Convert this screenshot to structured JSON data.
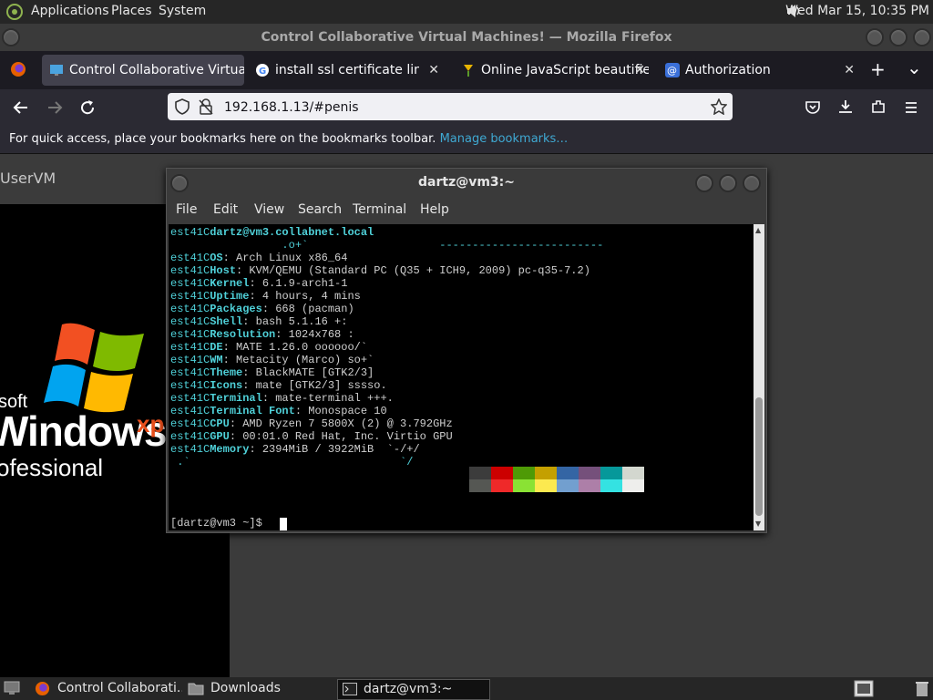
{
  "top_panel": {
    "menus": [
      "Applications",
      "Places",
      "System"
    ],
    "clock": "Wed Mar 15, 10:35 PM"
  },
  "firefox": {
    "window_title": "Control Collaborative Virtual Machines! — Mozilla Firefox",
    "tabs": [
      {
        "label": "Control Collaborative Virtua",
        "icon": "monitor-icon",
        "active": true
      },
      {
        "label": "install ssl certificate linux - G",
        "icon": "google-icon",
        "active": false
      },
      {
        "label": "Online JavaScript beautifier",
        "icon": "beautifier-icon",
        "active": false
      },
      {
        "label": "Authorization",
        "icon": "at-icon",
        "active": false
      }
    ],
    "tab_close": "✕",
    "new_tab": "+",
    "list_tabs": "⌄",
    "url": "192.168.1.13/#penis",
    "bookmarks_text": "For quick access, place your bookmarks here on the bookmarks toolbar.",
    "manage_bookmarks": "Manage bookmarks…"
  },
  "page": {
    "vm_tab_label": "UserVM",
    "xp": {
      "soft": "soft",
      "windows": "Windows",
      "xp": "xp",
      "pro": "ofessional"
    }
  },
  "terminal": {
    "title": "dartz@vm3:~",
    "menu": [
      "File",
      "Edit",
      "View",
      "Search",
      "Terminal",
      "Help"
    ],
    "lines": [
      {
        "pre": "est41C",
        "key": "dartz@vm3.collabnet.local",
        "val": ""
      },
      {
        "pre": "                 .o+`",
        "key": "",
        "val": "                    -------------------------"
      },
      {
        "pre": "est41C",
        "key": "OS",
        "val": ": Arch Linux x86_64"
      },
      {
        "pre": "est41C",
        "key": "Host",
        "val": ": KVM/QEMU (Standard PC (Q35 + ICH9, 2009) pc-q35-7.2)"
      },
      {
        "pre": "est41C",
        "key": "Kernel",
        "val": ": 6.1.9-arch1-1"
      },
      {
        "pre": "est41C",
        "key": "Uptime",
        "val": ": 4 hours, 4 mins"
      },
      {
        "pre": "est41C",
        "key": "Packages",
        "val": ": 668 (pacman)"
      },
      {
        "pre": "est41C",
        "key": "Shell",
        "val": ": bash 5.1.16 +:"
      },
      {
        "pre": "est41C",
        "key": "Resolution",
        "val": ": 1024x768 :"
      },
      {
        "pre": "est41C",
        "key": "DE",
        "val": ": MATE 1.26.0 oooooo/`"
      },
      {
        "pre": "est41C",
        "key": "WM",
        "val": ": Metacity (Marco) so+`"
      },
      {
        "pre": "est41C",
        "key": "Theme",
        "val": ": BlackMATE [GTK2/3]"
      },
      {
        "pre": "est41C",
        "key": "Icons",
        "val": ": mate [GTK2/3] sssso."
      },
      {
        "pre": "est41C",
        "key": "Terminal",
        "val": ": mate-terminal +++."
      },
      {
        "pre": "est41C",
        "key": "Terminal Font",
        "val": ": Monospace 10"
      },
      {
        "pre": "est41C",
        "key": "CPU",
        "val": ": AMD Ryzen 7 5800X (2) @ 3.792GHz"
      },
      {
        "pre": "est41C",
        "key": "GPU",
        "val": ": 00:01.0 Red Hat, Inc. Virtio GPU"
      },
      {
        "pre": "est41C",
        "key": "Memory",
        "val": ": 2394MiB / 3922MiB  `-/+/"
      },
      {
        "pre": " .`",
        "key": "",
        "val": "                                `/"
      }
    ],
    "prompt": "[dartz@vm3 ~]$ ",
    "swatches_top": [
      "#3c3c3c",
      "#cc0000",
      "#4e9a06",
      "#c4a000",
      "#3465a4",
      "#75507b",
      "#06989a",
      "#d3d7cf"
    ],
    "swatches_bottom": [
      "#555753",
      "#ef2929",
      "#8ae234",
      "#fce94f",
      "#729fcf",
      "#ad7fa8",
      "#34e2e2",
      "#eeeeec"
    ]
  },
  "taskbar": {
    "items": [
      {
        "label": "Control Collaborati...",
        "icon": "firefox-icon"
      },
      {
        "label": "Downloads",
        "icon": "folder-icon"
      },
      {
        "label": "dartz@vm3:~",
        "icon": "terminal-icon"
      }
    ]
  },
  "colors": {
    "accent_link": "#3fa9d3",
    "term_cyan": "#4fd0d8"
  }
}
